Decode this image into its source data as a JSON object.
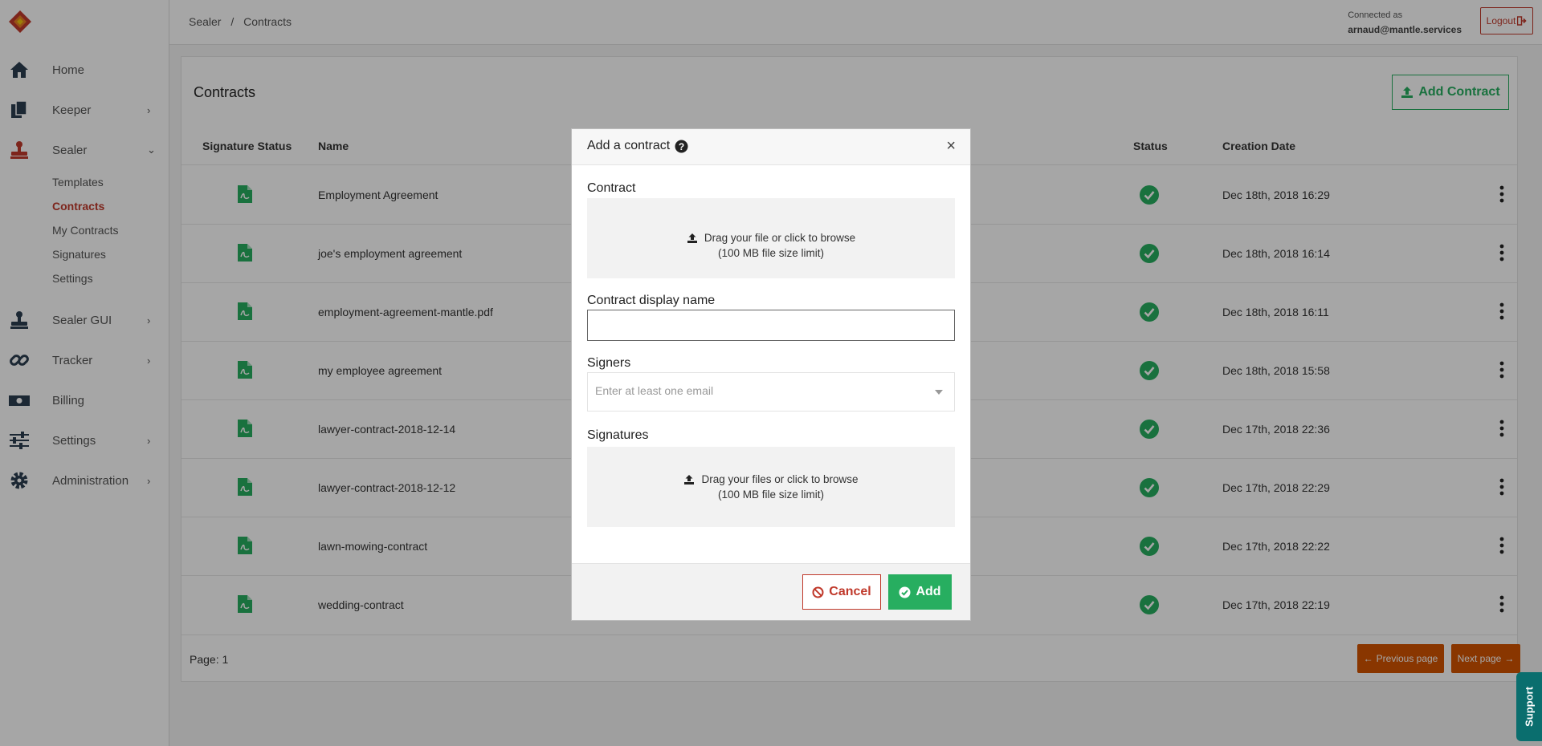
{
  "colors": {
    "accent_red": "#c0392b",
    "accent_green": "#27ae60",
    "pager_orange": "#d35400",
    "support_teal": "#0a6e6e"
  },
  "sidebar": {
    "items": [
      {
        "label": "Home",
        "icon": "home-icon"
      },
      {
        "label": "Keeper",
        "icon": "documents-icon"
      },
      {
        "label": "Sealer",
        "icon": "stamp-icon"
      },
      {
        "label": "Sealer GUI",
        "icon": "stamp-icon"
      },
      {
        "label": "Tracker",
        "icon": "link-icon"
      },
      {
        "label": "Billing",
        "icon": "money-icon"
      },
      {
        "label": "Settings",
        "icon": "sliders-icon"
      },
      {
        "label": "Administration",
        "icon": "gear-icon"
      }
    ],
    "sealer_sub": [
      "Templates",
      "Contracts",
      "My Contracts",
      "Signatures",
      "Settings"
    ],
    "active_sub": "Contracts"
  },
  "topbar": {
    "breadcrumb": [
      "Sealer",
      "/",
      "Contracts"
    ],
    "connected_label": "Connected as",
    "user_email": "arnaud@mantle.services",
    "logout_label": "Logout"
  },
  "main": {
    "title": "Contracts",
    "add_button": "Add Contract",
    "columns": [
      "Signature Status",
      "Name",
      "Status",
      "Creation Date"
    ],
    "rows": [
      {
        "name": "Employment Agreement",
        "date": "Dec 18th, 2018 16:29"
      },
      {
        "name": "joe's employment agreement",
        "date": "Dec 18th, 2018 16:14"
      },
      {
        "name": "employment-agreement-mantle.pdf",
        "date": "Dec 18th, 2018 16:11"
      },
      {
        "name": "my employee agreement",
        "date": "Dec 18th, 2018 15:58"
      },
      {
        "name": "lawyer-contract-2018-12-14",
        "date": "Dec 17th, 2018 22:36"
      },
      {
        "name": "lawyer-contract-2018-12-12",
        "date": "Dec 17th, 2018 22:29"
      },
      {
        "name": "lawn-mowing-contract",
        "date": "Dec 17th, 2018 22:22"
      },
      {
        "name": "wedding-contract",
        "date": "Dec 17th, 2018 22:19"
      }
    ],
    "page_label": "Page: 1",
    "prev_label": "Previous page",
    "next_label": "Next page"
  },
  "modal": {
    "title": "Add a contract",
    "contract_label": "Contract",
    "contract_drop_line1": "Drag your file or click to browse",
    "contract_drop_line2": "(100 MB file size limit)",
    "display_name_label": "Contract display name",
    "display_name_value": "",
    "signers_label": "Signers",
    "signers_placeholder": "Enter at least one email",
    "signatures_label": "Signatures",
    "signatures_drop_line1": "Drag your files or click to browse",
    "signatures_drop_line2": "(100 MB file size limit)",
    "cancel_label": "Cancel",
    "add_label": "Add"
  },
  "support_label": "Support"
}
